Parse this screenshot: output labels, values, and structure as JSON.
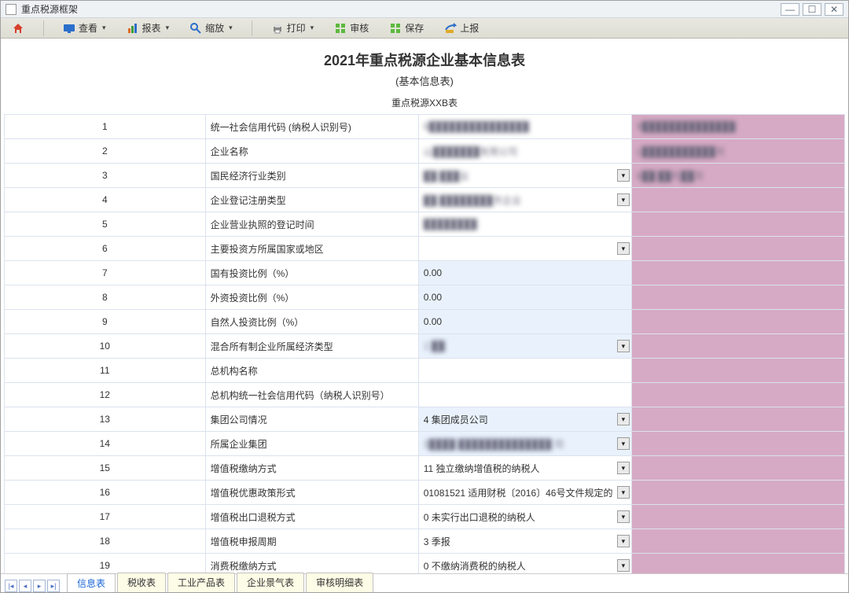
{
  "window": {
    "title": "重点税源框架"
  },
  "toolbar": {
    "home": "主页",
    "view": "查看",
    "report": "报表",
    "zoom": "缩放",
    "print": "打印",
    "audit": "审核",
    "save": "保存",
    "submit": "上报"
  },
  "form": {
    "title": "2021年重点税源企业基本信息表",
    "subtitle": "(基本信息表)",
    "table_name": "重点税源XXB表"
  },
  "rows": [
    {
      "n": "1",
      "label": "统一社会信用代码 (纳税人识别号)",
      "value": "9███████████████",
      "cmp": "9██████████████",
      "dd": false,
      "ed": false,
      "bv": true,
      "bc": true
    },
    {
      "n": "2",
      "label": "企业名称",
      "value": "山███████有限公司",
      "cmp": "L███████████司",
      "dd": false,
      "ed": false,
      "bv": true,
      "bc": true
    },
    {
      "n": "3",
      "label": "国民经济行业类别",
      "value": "██ ███业",
      "cmp": "6██ ██托██司",
      "dd": true,
      "ed": false,
      "bv": true,
      "bc": true
    },
    {
      "n": "4",
      "label": "企业登记注册类型",
      "value": "██ ████████市企业",
      "cmp": "",
      "dd": true,
      "ed": false,
      "bv": true
    },
    {
      "n": "5",
      "label": "企业营业执照的登记时间",
      "value": "████████",
      "cmp": "",
      "dd": false,
      "ed": false,
      "bv": true
    },
    {
      "n": "6",
      "label": "主要投资方所属国家或地区",
      "value": "",
      "cmp": "",
      "dd": true,
      "ed": false
    },
    {
      "n": "7",
      "label": "国有投资比例（%）",
      "value": "0.00",
      "cmp": "",
      "dd": false,
      "ed": true
    },
    {
      "n": "8",
      "label": "外资投资比例（%）",
      "value": "0.00",
      "cmp": "",
      "dd": false,
      "ed": true
    },
    {
      "n": "9",
      "label": "自然人投资比例（%）",
      "value": "0.00",
      "cmp": "",
      "dd": false,
      "ed": true
    },
    {
      "n": "10",
      "label": "混合所有制企业所属经济类型",
      "value": "1 ██",
      "cmp": "",
      "dd": true,
      "ed": true,
      "bv": true
    },
    {
      "n": "11",
      "label": "总机构名称",
      "value": "",
      "cmp": "",
      "dd": false,
      "ed": false
    },
    {
      "n": "12",
      "label": "总机构统一社会信用代码（纳税人识别号）",
      "value": "",
      "cmp": "",
      "dd": false,
      "ed": false
    },
    {
      "n": "13",
      "label": "集团公司情况",
      "value": "4 集团成员公司",
      "cmp": "",
      "dd": true,
      "ed": true
    },
    {
      "n": "14",
      "label": "所属企业集团",
      "value": "3████ ██████████████ 司",
      "cmp": "",
      "dd": true,
      "ed": true,
      "bv": true
    },
    {
      "n": "15",
      "label": "增值税缴纳方式",
      "value": "11 独立缴纳增值税的纳税人",
      "cmp": "",
      "dd": true,
      "ed": false
    },
    {
      "n": "16",
      "label": "增值税优惠政策形式",
      "value": "01081521 适用财税〔2016〕46号文件规定的",
      "cmp": "",
      "dd": true,
      "ed": false
    },
    {
      "n": "17",
      "label": "增值税出口退税方式",
      "value": "0 未实行出口退税的纳税人",
      "cmp": "",
      "dd": true,
      "ed": false
    },
    {
      "n": "18",
      "label": "增值税申报周期",
      "value": "3 季报",
      "cmp": "",
      "dd": true,
      "ed": false
    },
    {
      "n": "19",
      "label": "消费税缴纳方式",
      "value": "0 不缴纳消费税的纳税人",
      "cmp": "",
      "dd": true,
      "ed": false
    }
  ],
  "tabs": [
    {
      "label": "信息表",
      "active": true
    },
    {
      "label": "税收表",
      "active": false
    },
    {
      "label": "工业产品表",
      "active": false
    },
    {
      "label": "企业景气表",
      "active": false
    },
    {
      "label": "审核明细表",
      "active": false
    }
  ]
}
